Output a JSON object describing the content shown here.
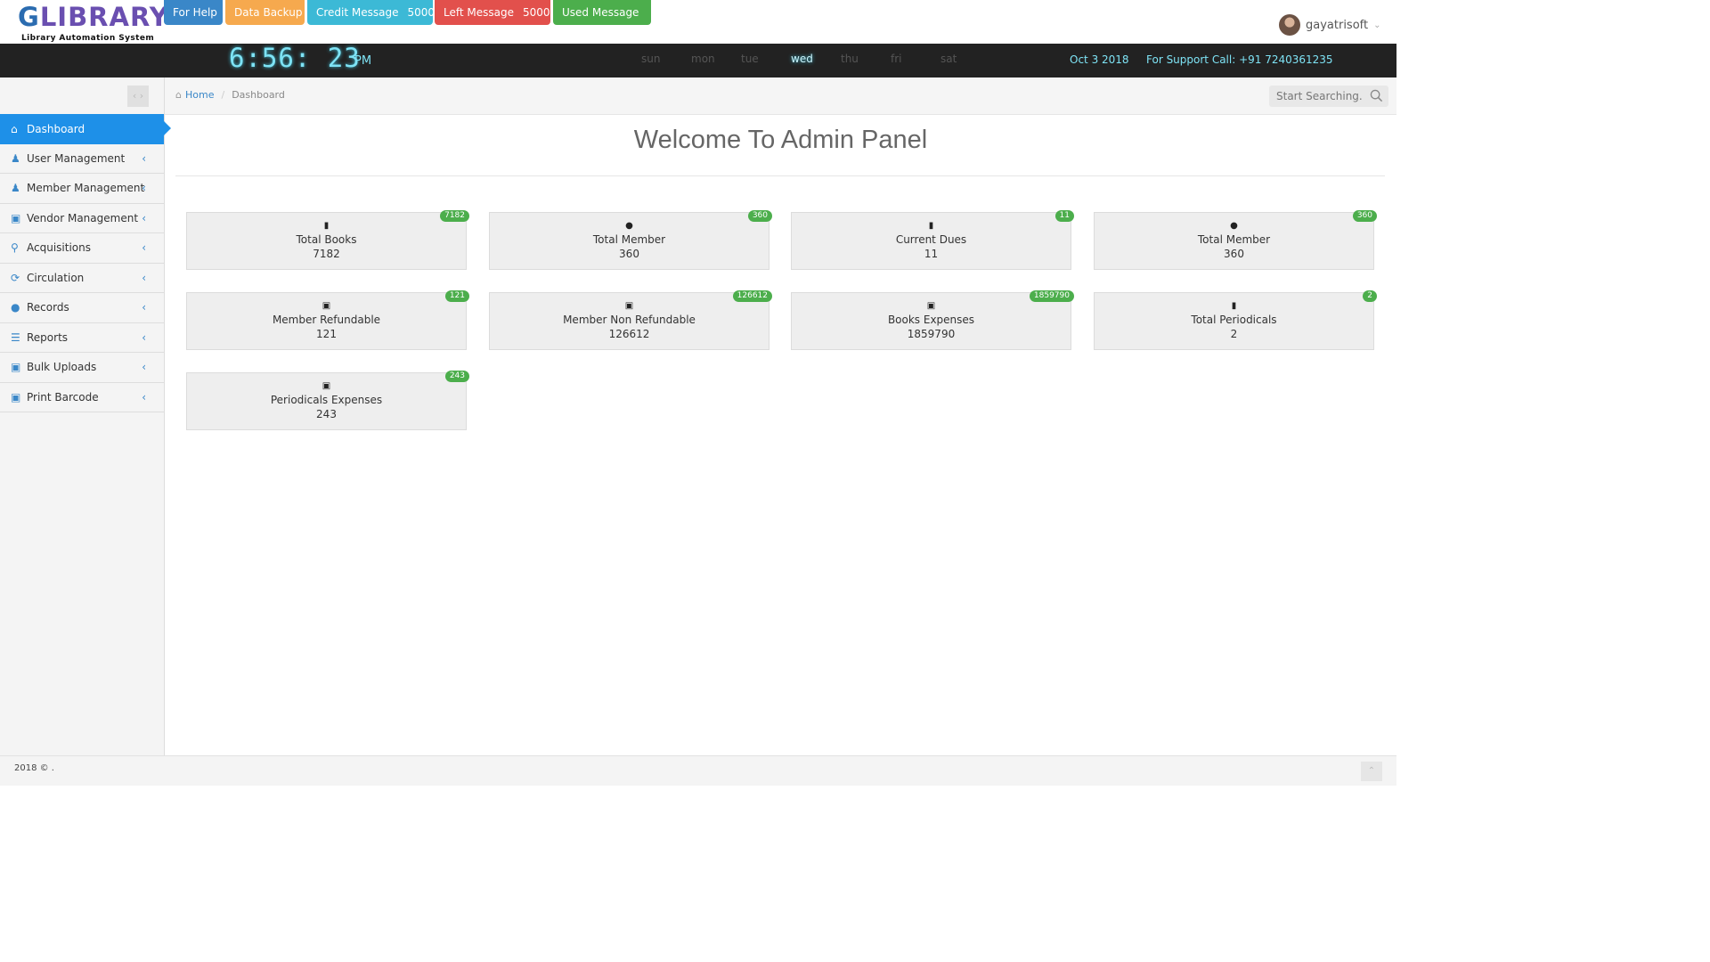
{
  "logo": {
    "word": "LIBRARY",
    "prefix": "G",
    "sub": "Library Automation System"
  },
  "top_buttons": {
    "help": "For Help",
    "backup": "Data Backup",
    "credit_label": "Credit Message",
    "credit_count": "5000",
    "left_label": "Left Message",
    "left_count": "5000",
    "used_label": "Used Message"
  },
  "user": {
    "name": "gayatrisoft"
  },
  "clockbar": {
    "time": "6:56: 23",
    "ampm": "PM",
    "days": [
      "sun",
      "mon",
      "tue",
      "wed",
      "thu",
      "fri",
      "sat"
    ],
    "active_day": "wed",
    "date": "Oct 3 2018",
    "support": "For Support Call: +91 7240361235"
  },
  "sidebar": {
    "items": [
      {
        "label": "Dashboard",
        "icon": "home-icon",
        "active": true
      },
      {
        "label": "User Management",
        "icon": "users-icon"
      },
      {
        "label": "Member Management",
        "icon": "members-icon"
      },
      {
        "label": "Vendor Management",
        "icon": "monitor-icon"
      },
      {
        "label": "Acquisitions",
        "icon": "key-icon"
      },
      {
        "label": "Circulation",
        "icon": "refresh-icon"
      },
      {
        "label": "Records",
        "icon": "info-icon"
      },
      {
        "label": "Reports",
        "icon": "layers-icon"
      },
      {
        "label": "Bulk Uploads",
        "icon": "monitor-icon"
      },
      {
        "label": "Print Barcode",
        "icon": "monitor-icon"
      }
    ]
  },
  "breadcrumb": {
    "home": "Home",
    "current": "Dashboard"
  },
  "search": {
    "placeholder": "Start Searching..."
  },
  "main": {
    "title": "Welcome To Admin Panel",
    "cards": [
      {
        "title": "Total Books",
        "value": "7182",
        "badge": "7182",
        "icon": "book-icon"
      },
      {
        "title": "Total Member",
        "value": "360",
        "badge": "360",
        "icon": "user-icon"
      },
      {
        "title": "Current Dues",
        "value": "11",
        "badge": "11",
        "icon": "book-icon"
      },
      {
        "title": "Total Member",
        "value": "360",
        "badge": "360",
        "icon": "user-icon"
      },
      {
        "title": "Member Refundable",
        "value": "121",
        "badge": "121",
        "icon": "money-icon"
      },
      {
        "title": "Member Non Refundable",
        "value": "126612",
        "badge": "126612",
        "icon": "money-icon"
      },
      {
        "title": "Books Expenses",
        "value": "1859790",
        "badge": "1859790",
        "icon": "money-icon"
      },
      {
        "title": "Total Periodicals",
        "value": "2",
        "badge": "2",
        "icon": "book-icon"
      },
      {
        "title": "Periodicals Expenses",
        "value": "243",
        "badge": "243",
        "icon": "money-icon"
      }
    ]
  },
  "footer": {
    "text": "2018 © ."
  }
}
